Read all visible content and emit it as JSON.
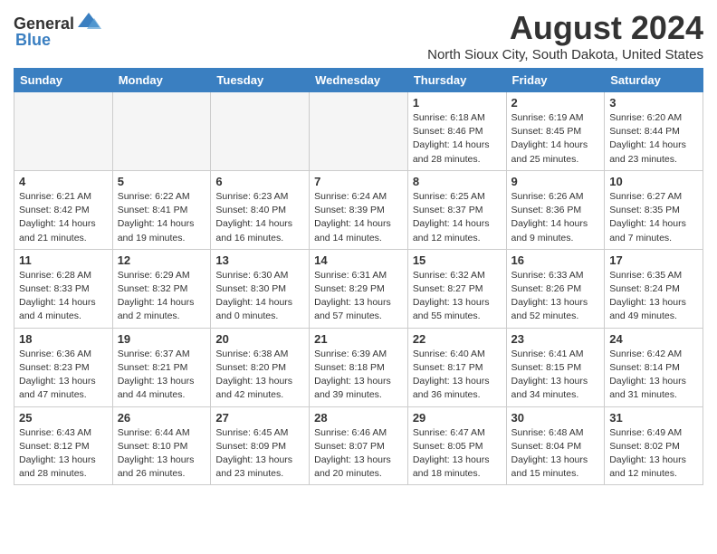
{
  "header": {
    "logo_general": "General",
    "logo_blue": "Blue",
    "month_year": "August 2024",
    "location": "North Sioux City, South Dakota, United States"
  },
  "weekdays": [
    "Sunday",
    "Monday",
    "Tuesday",
    "Wednesday",
    "Thursday",
    "Friday",
    "Saturday"
  ],
  "weeks": [
    [
      {
        "day": "",
        "info": ""
      },
      {
        "day": "",
        "info": ""
      },
      {
        "day": "",
        "info": ""
      },
      {
        "day": "",
        "info": ""
      },
      {
        "day": "1",
        "info": "Sunrise: 6:18 AM\nSunset: 8:46 PM\nDaylight: 14 hours\nand 28 minutes."
      },
      {
        "day": "2",
        "info": "Sunrise: 6:19 AM\nSunset: 8:45 PM\nDaylight: 14 hours\nand 25 minutes."
      },
      {
        "day": "3",
        "info": "Sunrise: 6:20 AM\nSunset: 8:44 PM\nDaylight: 14 hours\nand 23 minutes."
      }
    ],
    [
      {
        "day": "4",
        "info": "Sunrise: 6:21 AM\nSunset: 8:42 PM\nDaylight: 14 hours\nand 21 minutes."
      },
      {
        "day": "5",
        "info": "Sunrise: 6:22 AM\nSunset: 8:41 PM\nDaylight: 14 hours\nand 19 minutes."
      },
      {
        "day": "6",
        "info": "Sunrise: 6:23 AM\nSunset: 8:40 PM\nDaylight: 14 hours\nand 16 minutes."
      },
      {
        "day": "7",
        "info": "Sunrise: 6:24 AM\nSunset: 8:39 PM\nDaylight: 14 hours\nand 14 minutes."
      },
      {
        "day": "8",
        "info": "Sunrise: 6:25 AM\nSunset: 8:37 PM\nDaylight: 14 hours\nand 12 minutes."
      },
      {
        "day": "9",
        "info": "Sunrise: 6:26 AM\nSunset: 8:36 PM\nDaylight: 14 hours\nand 9 minutes."
      },
      {
        "day": "10",
        "info": "Sunrise: 6:27 AM\nSunset: 8:35 PM\nDaylight: 14 hours\nand 7 minutes."
      }
    ],
    [
      {
        "day": "11",
        "info": "Sunrise: 6:28 AM\nSunset: 8:33 PM\nDaylight: 14 hours\nand 4 minutes."
      },
      {
        "day": "12",
        "info": "Sunrise: 6:29 AM\nSunset: 8:32 PM\nDaylight: 14 hours\nand 2 minutes."
      },
      {
        "day": "13",
        "info": "Sunrise: 6:30 AM\nSunset: 8:30 PM\nDaylight: 14 hours\nand 0 minutes."
      },
      {
        "day": "14",
        "info": "Sunrise: 6:31 AM\nSunset: 8:29 PM\nDaylight: 13 hours\nand 57 minutes."
      },
      {
        "day": "15",
        "info": "Sunrise: 6:32 AM\nSunset: 8:27 PM\nDaylight: 13 hours\nand 55 minutes."
      },
      {
        "day": "16",
        "info": "Sunrise: 6:33 AM\nSunset: 8:26 PM\nDaylight: 13 hours\nand 52 minutes."
      },
      {
        "day": "17",
        "info": "Sunrise: 6:35 AM\nSunset: 8:24 PM\nDaylight: 13 hours\nand 49 minutes."
      }
    ],
    [
      {
        "day": "18",
        "info": "Sunrise: 6:36 AM\nSunset: 8:23 PM\nDaylight: 13 hours\nand 47 minutes."
      },
      {
        "day": "19",
        "info": "Sunrise: 6:37 AM\nSunset: 8:21 PM\nDaylight: 13 hours\nand 44 minutes."
      },
      {
        "day": "20",
        "info": "Sunrise: 6:38 AM\nSunset: 8:20 PM\nDaylight: 13 hours\nand 42 minutes."
      },
      {
        "day": "21",
        "info": "Sunrise: 6:39 AM\nSunset: 8:18 PM\nDaylight: 13 hours\nand 39 minutes."
      },
      {
        "day": "22",
        "info": "Sunrise: 6:40 AM\nSunset: 8:17 PM\nDaylight: 13 hours\nand 36 minutes."
      },
      {
        "day": "23",
        "info": "Sunrise: 6:41 AM\nSunset: 8:15 PM\nDaylight: 13 hours\nand 34 minutes."
      },
      {
        "day": "24",
        "info": "Sunrise: 6:42 AM\nSunset: 8:14 PM\nDaylight: 13 hours\nand 31 minutes."
      }
    ],
    [
      {
        "day": "25",
        "info": "Sunrise: 6:43 AM\nSunset: 8:12 PM\nDaylight: 13 hours\nand 28 minutes."
      },
      {
        "day": "26",
        "info": "Sunrise: 6:44 AM\nSunset: 8:10 PM\nDaylight: 13 hours\nand 26 minutes."
      },
      {
        "day": "27",
        "info": "Sunrise: 6:45 AM\nSunset: 8:09 PM\nDaylight: 13 hours\nand 23 minutes."
      },
      {
        "day": "28",
        "info": "Sunrise: 6:46 AM\nSunset: 8:07 PM\nDaylight: 13 hours\nand 20 minutes."
      },
      {
        "day": "29",
        "info": "Sunrise: 6:47 AM\nSunset: 8:05 PM\nDaylight: 13 hours\nand 18 minutes."
      },
      {
        "day": "30",
        "info": "Sunrise: 6:48 AM\nSunset: 8:04 PM\nDaylight: 13 hours\nand 15 minutes."
      },
      {
        "day": "31",
        "info": "Sunrise: 6:49 AM\nSunset: 8:02 PM\nDaylight: 13 hours\nand 12 minutes."
      }
    ]
  ]
}
